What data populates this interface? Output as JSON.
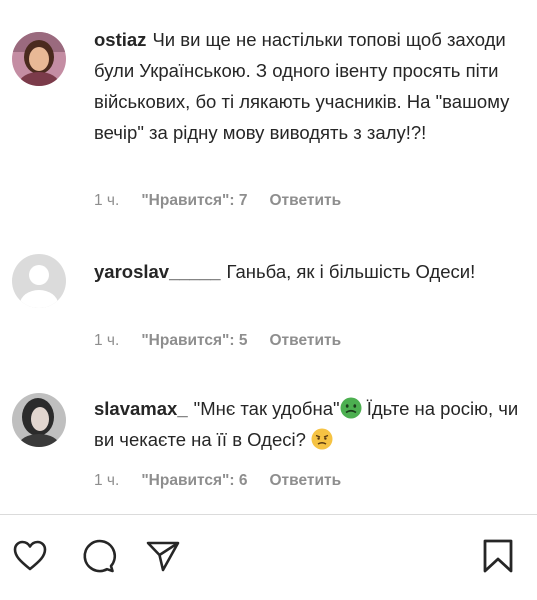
{
  "comments": [
    {
      "username": "ostiaz",
      "text": "Чи ви ще не настільки топові щоб заходи були Українською. З одного івенту просять піти військових, бо ті лякають учасників. На \"вашому вечір\" за рідну мову виводять з залу!?!",
      "time": "1 ч.",
      "likes": "\"Нравится\": 7",
      "reply": "Ответить"
    },
    {
      "username": "yaroslav_____",
      "text": "Ганьба, як і більшість Одеси!",
      "time": "1 ч.",
      "likes": "\"Нравится\": 5",
      "reply": "Ответить"
    },
    {
      "username": "slavamax_",
      "text_before_emoji": "\"Мнє так удобна\"",
      "text_after_emoji": " Їдьте на росію, чи ви чекаєте на її в Одесі? ",
      "time": "1 ч.",
      "likes": "\"Нравится\": 6",
      "reply": "Ответить",
      "emojis": [
        "nauseated-face-emoji",
        "angry-face-emoji"
      ]
    }
  ],
  "action_bar": {
    "icons": [
      "heart-icon",
      "comment-icon",
      "share-icon",
      "bookmark-icon"
    ]
  }
}
